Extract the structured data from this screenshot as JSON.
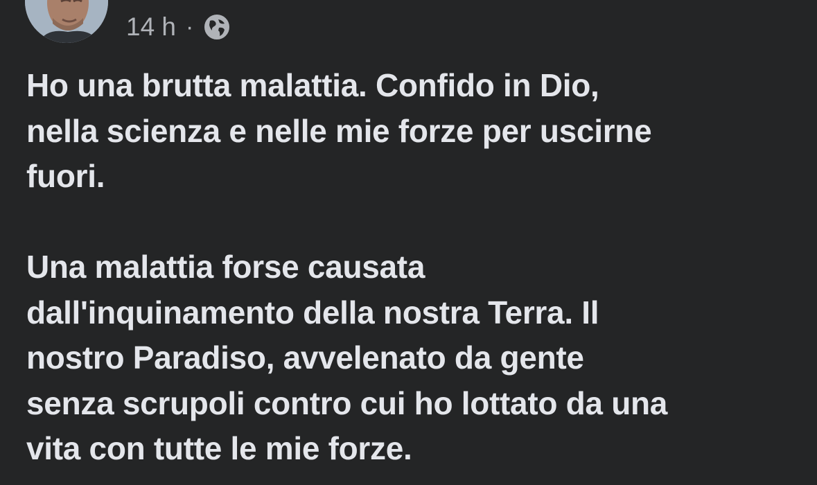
{
  "post": {
    "timestamp": "14 h",
    "separator": "·",
    "privacy_icon": "globe-icon",
    "paragraphs": [
      "Ho una brutta malattia. Confido in Dio,\nnella scienza e nelle mie forze per uscirne\nfuori.",
      "Una malattia forse causata\ndall'inquinamento della nostra Terra. Il\nnostro Paradiso, avvelenato da gente\nsenza scrupoli contro cui ho lottato da una\nvita con tutte le mie forze."
    ]
  },
  "colors": {
    "background": "#242526",
    "primary_text": "#e4e6eb",
    "secondary_text": "#b0b3b8"
  }
}
